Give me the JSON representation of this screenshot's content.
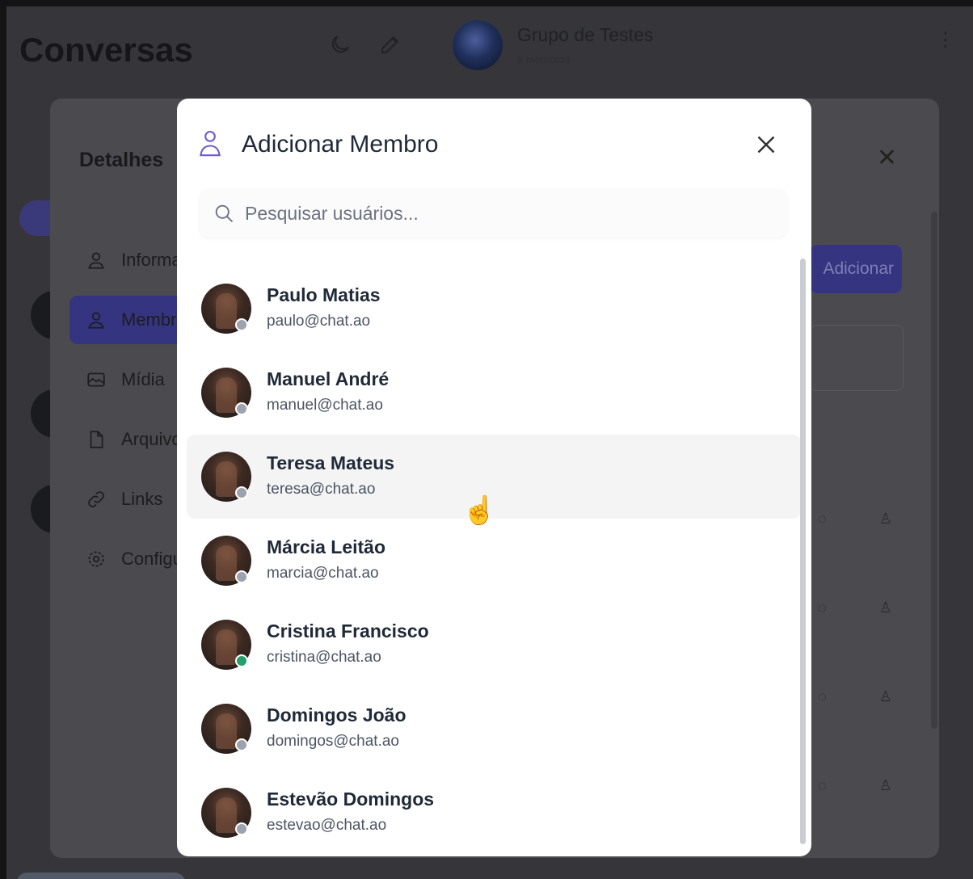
{
  "app": {
    "title": "Conversas",
    "colors": {
      "accent": "#353480",
      "overlay": "#36363a",
      "online": "#22a06b",
      "offline": "#9ca3af"
    }
  },
  "chat_header": {
    "name": "Grupo de Testes",
    "subtitle": "8 membros"
  },
  "details_panel": {
    "title": "Detalhes",
    "nav": [
      {
        "label": "Informações",
        "icon": "user-icon"
      },
      {
        "label": "Membros",
        "icon": "user-icon",
        "active": true
      },
      {
        "label": "Mídia",
        "icon": "image-icon"
      },
      {
        "label": "Arquivos",
        "icon": "file-icon"
      },
      {
        "label": "Links",
        "icon": "link-icon"
      },
      {
        "label": "Configurações",
        "icon": "settings-icon"
      }
    ],
    "add_label": "Adicionar"
  },
  "modal": {
    "title": "Adicionar Membro",
    "search_placeholder": "Pesquisar usuários...",
    "users": [
      {
        "name": "Paulo Matias",
        "email": "paulo@chat.ao",
        "status": "offline"
      },
      {
        "name": "Manuel André",
        "email": "manuel@chat.ao",
        "status": "offline"
      },
      {
        "name": "Teresa Mateus",
        "email": "teresa@chat.ao",
        "status": "offline",
        "hovered": true
      },
      {
        "name": "Márcia Leitão",
        "email": "marcia@chat.ao",
        "status": "offline"
      },
      {
        "name": "Cristina Francisco",
        "email": "cristina@chat.ao",
        "status": "online"
      },
      {
        "name": "Domingos João",
        "email": "domingos@chat.ao",
        "status": "offline"
      },
      {
        "name": "Estevão Domingos",
        "email": "estevao@chat.ao",
        "status": "offline"
      }
    ]
  }
}
